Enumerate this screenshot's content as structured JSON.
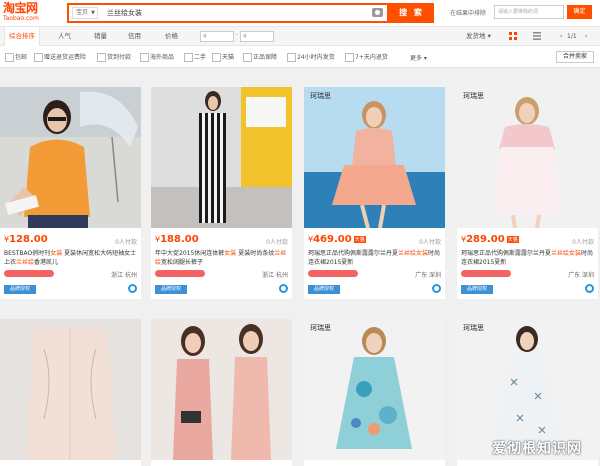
{
  "header": {
    "logo_main": "淘宝网",
    "logo_sub": "Taobao.com",
    "search_scope": "宝贝",
    "search_query": "兰丝绘女装",
    "search_button": "搜 索",
    "filter_label": "在结果中排除",
    "filter_placeholder": "请输入要排除的词",
    "confirm_button": "确定"
  },
  "sortbar": {
    "items": [
      "综合排序",
      "人气",
      "销量",
      "信用",
      "价格"
    ],
    "price_from": "¥",
    "price_to": "¥",
    "ship_from": "发货地",
    "page_info": "1/1"
  },
  "filters": [
    "包邮",
    "赠送退货运费险",
    "货到付款",
    "海外商品",
    "二手",
    "天猫",
    "正品保障",
    "24小时内发货",
    "7+天内退货"
  ],
  "more_label": "更多",
  "merge_label": "合并卖家",
  "products": [
    {
      "price": "128.00",
      "buyers": "0人付款",
      "title_parts": [
        [
          "BESTBAO俏时刊",
          false
        ],
        [
          "女装",
          true
        ],
        [
          " 夏装休闲宽松大码短袖女士上衣",
          false
        ],
        [
          "兰丝绘",
          true
        ],
        [
          "香港凯儿",
          false
        ]
      ],
      "location": "浙江 杭州",
      "badge": "品牌授权",
      "brand_label": "",
      "tmall": false
    },
    {
      "price": "188.00",
      "buyers": "0人付款",
      "title_parts": [
        [
          "年中大促2015休闲连体裤",
          false
        ],
        [
          "女装",
          true
        ],
        [
          " 夏装时尚条纹",
          false
        ],
        [
          "兰丝绘",
          true
        ],
        [
          "宽松阔腿长裤子",
          false
        ]
      ],
      "location": "浙江 杭州",
      "badge": "品牌授权",
      "brand_label": "",
      "tmall": false
    },
    {
      "price": "469.00",
      "buyers": "0人付款",
      "title_parts": [
        [
          "珂瑞思正品代购佩斯露露尔兰丹夏",
          false
        ],
        [
          "兰丝",
          true
        ],
        [
          "绘女装",
          true
        ],
        [
          "时尚连衣裙2015夏新",
          false
        ]
      ],
      "location": "广东 深圳",
      "badge": "品牌授权",
      "brand_label": "珂瑞思",
      "tmall": true
    },
    {
      "price": "289.00",
      "buyers": "0人付款",
      "title_parts": [
        [
          "珂瑞思正品代购佩斯露露尔兰丹夏",
          false
        ],
        [
          "兰丝",
          true
        ],
        [
          "绘女装",
          true
        ],
        [
          "时尚连衣裙2015夏新",
          false
        ]
      ],
      "location": "广东 深圳",
      "badge": "品牌授权",
      "brand_label": "珂瑞思",
      "tmall": true
    }
  ],
  "second_row_brand": [
    "",
    "",
    "珂瑞思",
    "珂瑞思"
  ],
  "watermark": "爱彻根知识网",
  "tmall_tag": "天猫",
  "currency": "¥",
  "colors": {
    "accent": "#ff5000",
    "price": "#ff4400",
    "badge": "#3d8fd6"
  }
}
